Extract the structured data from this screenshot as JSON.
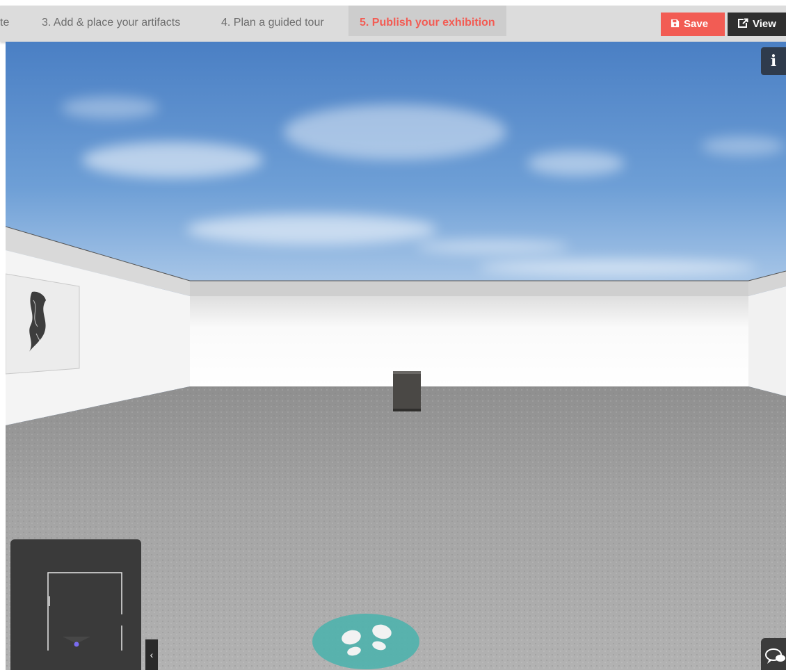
{
  "steps": {
    "partial_label": "te",
    "step3_label": "3. Add & place your artifacts",
    "step4_label": "4. Plan a guided tour",
    "step5_label": "5. Publish your exhibition"
  },
  "actions": {
    "save_label": "Save",
    "view_label": "View"
  },
  "icons": {
    "save": "floppy-disk-icon",
    "view": "external-link-icon",
    "info": "info-icon",
    "walk": "footprints-icon",
    "chat": "chat-bubbles-icon",
    "collapse": "chevron-left-icon"
  },
  "scene": {
    "info_glyph": "i",
    "minimap_toggle_glyph": "‹"
  },
  "colors": {
    "accent": "#f25c54",
    "dark_button": "#2f2f2f",
    "walk_marker": "#4fb3ad",
    "step_bar": "#dcdcdc"
  }
}
